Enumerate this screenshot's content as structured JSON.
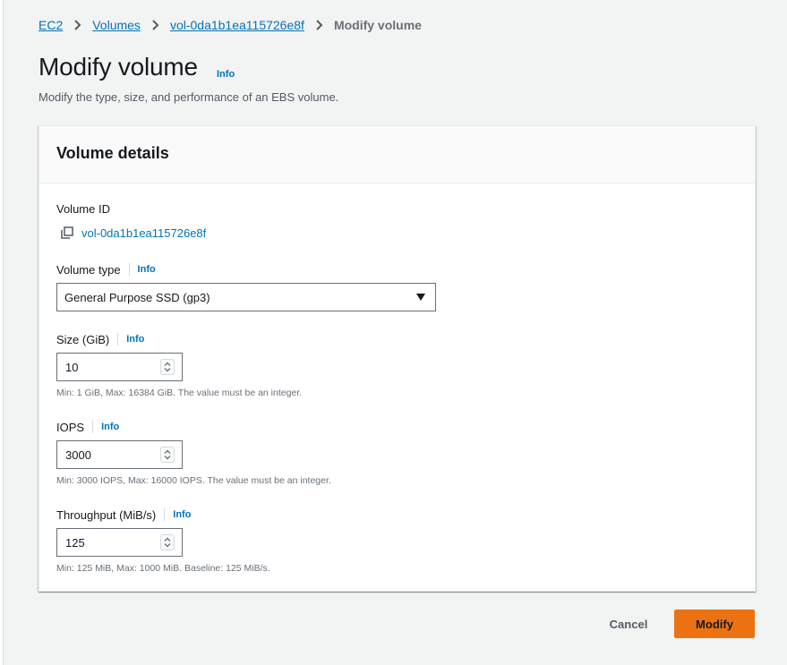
{
  "breadcrumb": {
    "items": [
      "EC2",
      "Volumes",
      "vol-0da1b1ea115726e8f"
    ],
    "current": "Modify volume"
  },
  "page": {
    "title": "Modify volume",
    "info": "Info",
    "description": "Modify the type, size, and performance of an EBS volume."
  },
  "panel": {
    "title": "Volume details",
    "volume_id": {
      "label": "Volume ID",
      "value": "vol-0da1b1ea115726e8f",
      "icon": "copy-icon"
    },
    "volume_type": {
      "label": "Volume type",
      "info": "Info",
      "selected": "General Purpose SSD (gp3)"
    },
    "size": {
      "label": "Size (GiB)",
      "info": "Info",
      "value": "10",
      "hint": "Min: 1 GiB, Max: 16384 GiB. The value must be an integer."
    },
    "iops": {
      "label": "IOPS",
      "info": "Info",
      "value": "3000",
      "hint": "Min: 3000 IOPS, Max: 16000 IOPS. The value must be an integer."
    },
    "throughput": {
      "label": "Throughput (MiB/s)",
      "info": "Info",
      "value": "125",
      "hint": "Min: 125 MiB, Max: 1000 MiB. Baseline: 125 MiB/s."
    }
  },
  "actions": {
    "cancel": "Cancel",
    "modify": "Modify"
  },
  "colors": {
    "link": "#0073bb",
    "primary_button": "#ec7211",
    "text": "#16191f",
    "muted": "#687078"
  }
}
